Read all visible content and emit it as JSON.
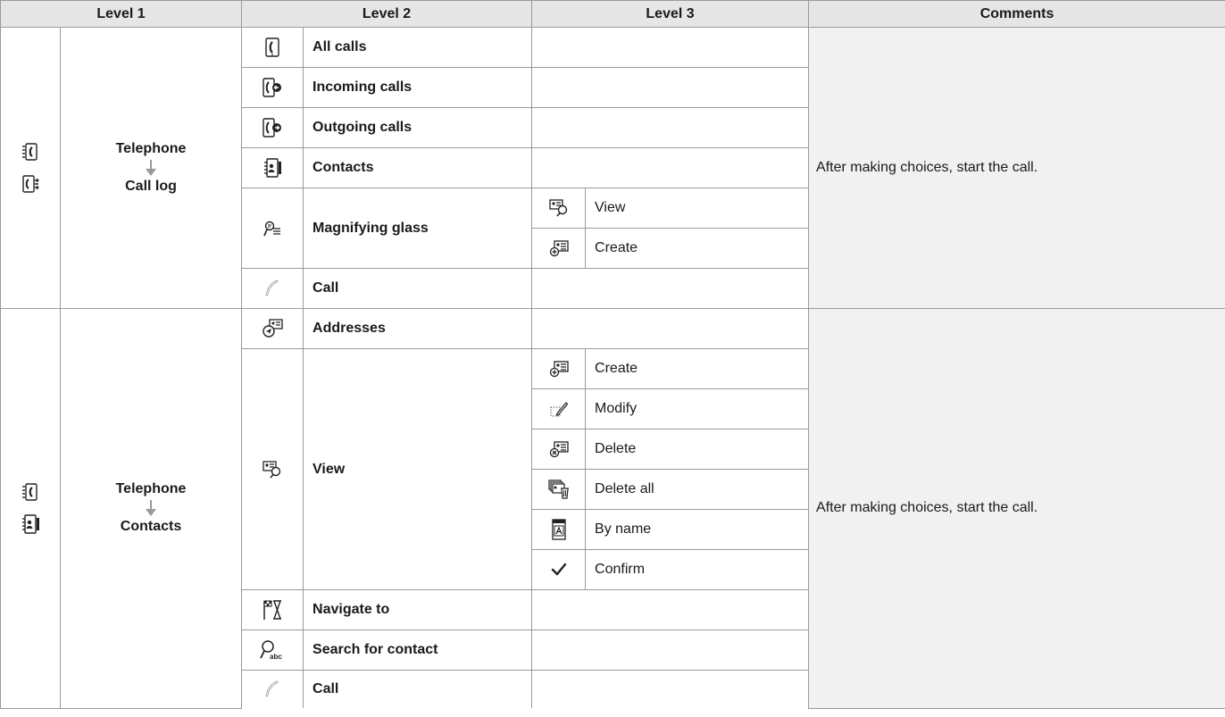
{
  "headers": {
    "level1": "Level 1",
    "level2": "Level 2",
    "level3": "Level 3",
    "comments": "Comments"
  },
  "section1": {
    "path_top": "Telephone",
    "path_bottom": "Call log",
    "comment": "After making choices, start the call.",
    "level2": {
      "all_calls": "All calls",
      "incoming_calls": "Incoming calls",
      "outgoing_calls": "Outgoing calls",
      "contacts": "Contacts",
      "magnifying_glass": "Magnifying glass",
      "call": "Call"
    },
    "level3": {
      "view": "View",
      "create": "Create"
    }
  },
  "section2": {
    "path_top": "Telephone",
    "path_bottom": "Contacts",
    "comment": "After making choices, start the call.",
    "level2": {
      "addresses": "Addresses",
      "view": "View",
      "navigate_to": "Navigate to",
      "search_for_contact": "Search for contact",
      "call": "Call"
    },
    "level3": {
      "create": "Create",
      "modify": "Modify",
      "delete": "Delete",
      "delete_all": "Delete all",
      "by_name": "By name",
      "confirm": "Confirm"
    }
  },
  "icons": [
    "telephone-icon",
    "call-log-icon",
    "contacts-icon",
    "all-calls-icon",
    "incoming-calls-icon",
    "outgoing-calls-icon",
    "magnifying-glass-icon",
    "view-contact-icon",
    "create-contact-icon",
    "handset-icon",
    "addresses-icon",
    "modify-icon",
    "delete-contact-icon",
    "delete-all-icon",
    "by-name-icon",
    "checkmark-icon",
    "navigate-flag-icon",
    "search-contact-icon"
  ],
  "colors": {
    "header_bg": "#e6e6e6",
    "comment_bg": "#f1f1f1",
    "border": "#9a9a9a",
    "arrow": "#999999"
  }
}
